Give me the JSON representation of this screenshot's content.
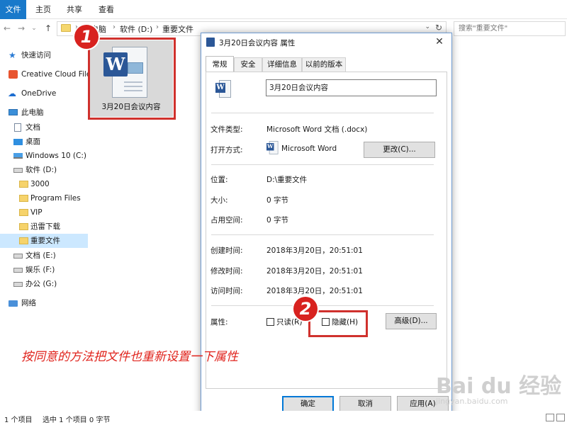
{
  "ribbon": {
    "tabs": [
      "文件",
      "主页",
      "共享",
      "查看"
    ]
  },
  "address": {
    "back": "←",
    "forward": "→",
    "down": "⌄",
    "up": "↑",
    "crumbs": [
      "此电脑",
      "软件 (D:)",
      "重要文件"
    ],
    "sep": "›",
    "dropdown": "⌄",
    "refresh": "↻",
    "search_placeholder": "搜索\"重要文件\""
  },
  "sidebar": {
    "items": [
      {
        "label": "快速访问",
        "icon": "quick-access-star-icon"
      },
      {
        "label": "Creative Cloud Files",
        "icon": "creative-cloud-icon"
      },
      {
        "label": "OneDrive",
        "icon": "onedrive-cloud-icon"
      },
      {
        "label": "此电脑",
        "icon": "this-pc-icon"
      },
      {
        "label": "文档",
        "icon": "documents-icon"
      },
      {
        "label": "桌面",
        "icon": "desktop-icon"
      },
      {
        "label": "Windows 10 (C:)",
        "icon": "windows-drive-icon"
      },
      {
        "label": "软件 (D:)",
        "icon": "drive-icon"
      },
      {
        "label": "3000",
        "icon": "folder-icon"
      },
      {
        "label": "Program Files",
        "icon": "folder-icon"
      },
      {
        "label": "VIP",
        "icon": "folder-icon"
      },
      {
        "label": "迅雷下载",
        "icon": "folder-icon"
      },
      {
        "label": "重要文件",
        "icon": "folder-icon"
      },
      {
        "label": "文档 (E:)",
        "icon": "drive-icon"
      },
      {
        "label": "娱乐 (F:)",
        "icon": "drive-icon"
      },
      {
        "label": "办公 (G:)",
        "icon": "drive-icon"
      },
      {
        "label": "网络",
        "icon": "network-icon"
      }
    ]
  },
  "file": {
    "name": "3月20日会议内容",
    "icon": "word-document-icon"
  },
  "markers": {
    "one": "1",
    "two": "2"
  },
  "dialog": {
    "title": "3月20日会议内容 属性",
    "close": "✕",
    "tabs": [
      "常规",
      "安全",
      "详细信息",
      "以前的版本"
    ],
    "name_value": "3月20日会议内容",
    "file_type_label": "文件类型:",
    "file_type_value": "Microsoft Word 文档 (.docx)",
    "opens_with_label": "打开方式:",
    "opens_with_value": "Microsoft Word",
    "change_button": "更改(C)...",
    "location_label": "位置:",
    "location_value": "D:\\重要文件",
    "size_label": "大小:",
    "size_value": "0 字节",
    "size_on_disk_label": "占用空间:",
    "size_on_disk_value": "0 字节",
    "created_label": "创建时间:",
    "created_value": "2018年3月20日，20:51:01",
    "modified_label": "修改时间:",
    "modified_value": "2018年3月20日，20:51:01",
    "accessed_label": "访问时间:",
    "accessed_value": "2018年3月20日，20:51:01",
    "attributes_label": "属性:",
    "readonly_label": "只读(R)",
    "readonly_checked": false,
    "hidden_label": "隐藏(H)",
    "hidden_checked": false,
    "advanced_button": "高级(D)...",
    "ok_button": "确定",
    "cancel_button": "取消",
    "apply_button": "应用(A)"
  },
  "annotation": "按同意的方法把文件也重新设置一下属性",
  "status": {
    "count": "1 个项目",
    "selected": "选中 1 个项目  0 字节"
  },
  "watermark": {
    "brand": "Bai du 经验",
    "url": "jingyan.baidu.com"
  },
  "colors": {
    "accent": "#1979ca",
    "highlight_red": "#d0312d",
    "selection": "#cce8ff",
    "word_blue": "#2b5797"
  }
}
